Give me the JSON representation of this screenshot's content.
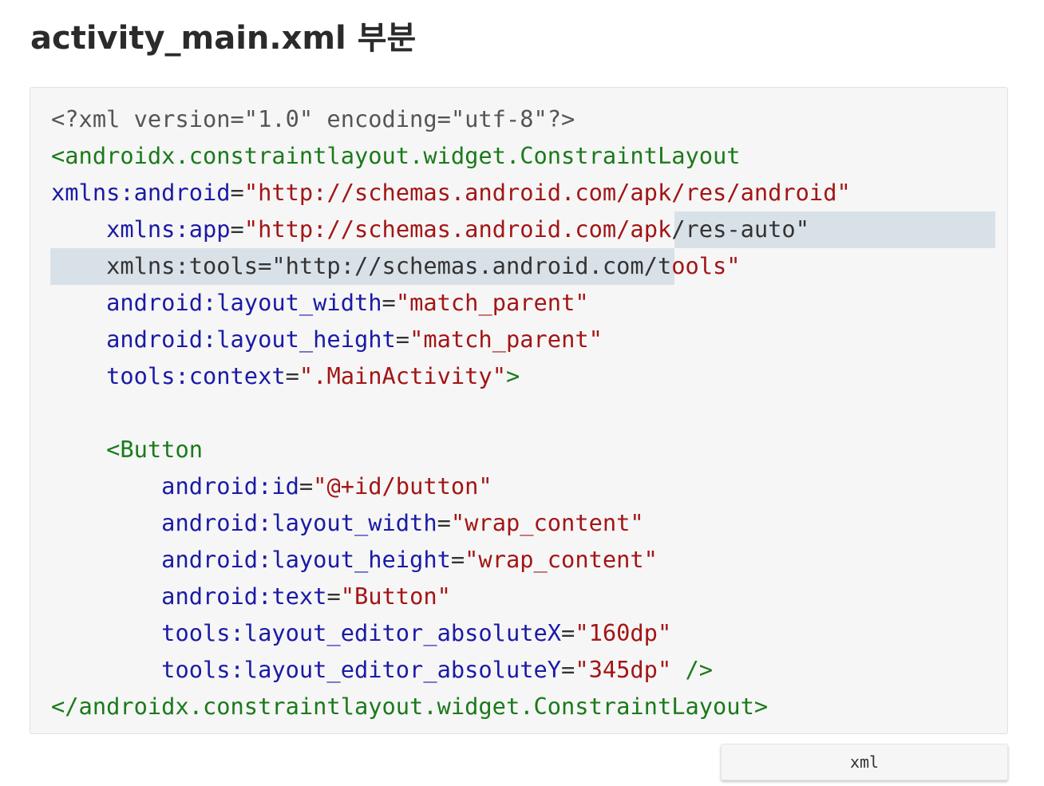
{
  "heading": "activity_main.xml 부분",
  "code_language": "xml",
  "colors": {
    "background": "#f6f6f6",
    "tag": "#1a7a1a",
    "attribute": "#1a1aa6",
    "value": "#a31515",
    "declaration": "#555555",
    "selection": "#d9e1e8"
  },
  "code_lines": [
    [
      {
        "t": "<?xml version=\"1.0\" encoding=\"utf-8\"?>",
        "c": "decl"
      }
    ],
    [
      {
        "t": "<androidx.constraintlayout.widget.ConstraintLayout",
        "c": "tag"
      }
    ],
    [
      {
        "t": "xmlns:android",
        "c": "attr"
      },
      {
        "t": "=",
        "c": "text"
      },
      {
        "t": "\"http://schemas.android.com/apk/res/android\"",
        "c": "val"
      }
    ],
    [
      {
        "t": "    ",
        "c": "text"
      },
      {
        "t": "xmlns:app",
        "c": "attr"
      },
      {
        "t": "=",
        "c": "text"
      },
      {
        "t": "\"http://schemas.android.com/apk",
        "c": "val"
      },
      {
        "t": "/res-auto\"",
        "c": "text"
      }
    ],
    [
      {
        "t": "    xmlns:tools=\"http://schemas.android.com/t",
        "c": "text"
      },
      {
        "t": "ools\"",
        "c": "val"
      }
    ],
    [
      {
        "t": "    ",
        "c": "text"
      },
      {
        "t": "android:layout_width",
        "c": "attr"
      },
      {
        "t": "=",
        "c": "text"
      },
      {
        "t": "\"match_parent\"",
        "c": "val"
      }
    ],
    [
      {
        "t": "    ",
        "c": "text"
      },
      {
        "t": "android:layout_height",
        "c": "attr"
      },
      {
        "t": "=",
        "c": "text"
      },
      {
        "t": "\"match_parent\"",
        "c": "val"
      }
    ],
    [
      {
        "t": "    ",
        "c": "text"
      },
      {
        "t": "tools:context",
        "c": "attr"
      },
      {
        "t": "=",
        "c": "text"
      },
      {
        "t": "\".MainActivity\"",
        "c": "val"
      },
      {
        "t": ">",
        "c": "tag"
      }
    ],
    [
      {
        "t": "",
        "c": "text"
      }
    ],
    [
      {
        "t": "    ",
        "c": "text"
      },
      {
        "t": "<Button",
        "c": "tag"
      }
    ],
    [
      {
        "t": "        ",
        "c": "text"
      },
      {
        "t": "android:id",
        "c": "attr"
      },
      {
        "t": "=",
        "c": "text"
      },
      {
        "t": "\"@+id/button\"",
        "c": "val"
      }
    ],
    [
      {
        "t": "        ",
        "c": "text"
      },
      {
        "t": "android:layout_width",
        "c": "attr"
      },
      {
        "t": "=",
        "c": "text"
      },
      {
        "t": "\"wrap_content\"",
        "c": "val"
      }
    ],
    [
      {
        "t": "        ",
        "c": "text"
      },
      {
        "t": "android:layout_height",
        "c": "attr"
      },
      {
        "t": "=",
        "c": "text"
      },
      {
        "t": "\"wrap_content\"",
        "c": "val"
      }
    ],
    [
      {
        "t": "        ",
        "c": "text"
      },
      {
        "t": "android:text",
        "c": "attr"
      },
      {
        "t": "=",
        "c": "text"
      },
      {
        "t": "\"Button\"",
        "c": "val"
      }
    ],
    [
      {
        "t": "        ",
        "c": "text"
      },
      {
        "t": "tools:layout_editor_absoluteX",
        "c": "attr"
      },
      {
        "t": "=",
        "c": "text"
      },
      {
        "t": "\"160dp\"",
        "c": "val"
      }
    ],
    [
      {
        "t": "        ",
        "c": "text"
      },
      {
        "t": "tools:layout_editor_absoluteY",
        "c": "attr"
      },
      {
        "t": "=",
        "c": "text"
      },
      {
        "t": "\"345dp\"",
        "c": "val"
      },
      {
        "t": " />",
        "c": "tag"
      }
    ],
    [
      {
        "t": "</androidx.constraintlayout.widget.ConstraintLayout>",
        "c": "tag"
      }
    ]
  ]
}
